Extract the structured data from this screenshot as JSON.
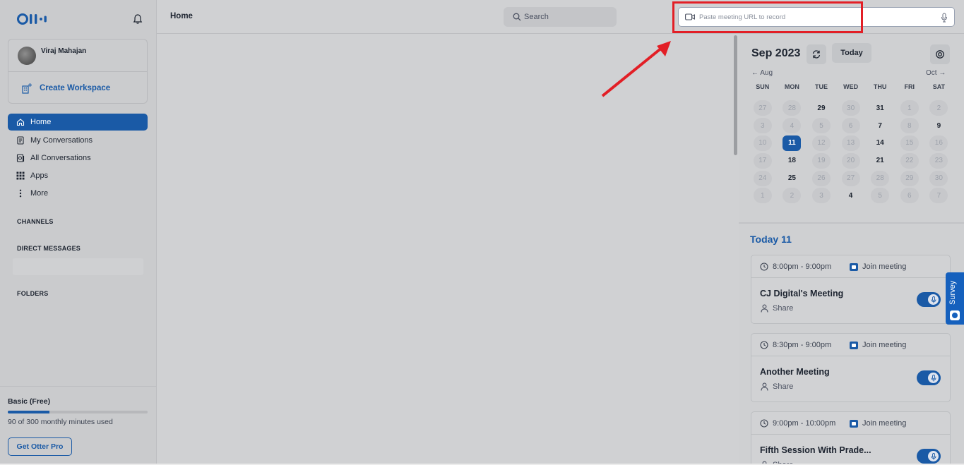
{
  "sidebar": {
    "logo_icon": "otter-logo-icon",
    "profile": {
      "name": "Viraj Mahajan"
    },
    "create_workspace": "Create Workspace",
    "nav": [
      {
        "label": "Home",
        "icon": "home-icon"
      },
      {
        "label": "My Conversations",
        "icon": "document-icon"
      },
      {
        "label": "All Conversations",
        "icon": "conversations-icon"
      },
      {
        "label": "Apps",
        "icon": "apps-grid-icon"
      },
      {
        "label": "More",
        "icon": "more-vertical-icon"
      }
    ],
    "sections": {
      "channels": "CHANNELS",
      "direct_messages": "DIRECT MESSAGES",
      "folders": "FOLDERS"
    },
    "plan": {
      "title": "Basic (Free)",
      "usage": "90 of 300 monthly minutes used",
      "used_fraction": 0.3,
      "cta": "Get Otter Pro"
    }
  },
  "topbar": {
    "title": "Home",
    "search_label": "Search",
    "url_placeholder": "Paste meeting URL to record"
  },
  "calendar": {
    "month": "Sep 2023",
    "today_button": "Today",
    "prev": "← Aug",
    "next": "Oct →",
    "weekdays": [
      "SUN",
      "MON",
      "TUE",
      "WED",
      "THU",
      "FRI",
      "SAT"
    ],
    "days": [
      [
        "27",
        "28",
        "29",
        "30",
        "31",
        "1",
        "2"
      ],
      [
        "3",
        "4",
        "5",
        "6",
        "7",
        "8",
        "9"
      ],
      [
        "10",
        "11",
        "12",
        "13",
        "14",
        "15",
        "16"
      ],
      [
        "17",
        "18",
        "19",
        "20",
        "21",
        "22",
        "23"
      ],
      [
        "24",
        "25",
        "26",
        "27",
        "28",
        "29",
        "30"
      ],
      [
        "1",
        "2",
        "3",
        "4",
        "5",
        "6",
        "7"
      ]
    ],
    "days_with_events": [
      "0-2",
      "0-4",
      "1-4",
      "1-6",
      "2-4",
      "3-1",
      "3-4",
      "4-1",
      "5-3"
    ],
    "selected": "2-1"
  },
  "today": {
    "label": "Today 11",
    "meetings": [
      {
        "time": "8:00pm - 9:00pm",
        "join": "Join meeting",
        "title": "CJ Digital's Meeting",
        "share": "Share"
      },
      {
        "time": "8:30pm - 9:00pm",
        "join": "Join meeting",
        "title": "Another Meeting",
        "share": "Share"
      },
      {
        "time": "9:00pm - 10:00pm",
        "join": "Join meeting",
        "title": "Fifth Session With Prade...",
        "share": "Share"
      }
    ]
  },
  "survey": {
    "label": "Survey"
  },
  "colors": {
    "accent": "#1a5aa6",
    "highlight": "#e21f26",
    "survey": "#1560bd"
  }
}
